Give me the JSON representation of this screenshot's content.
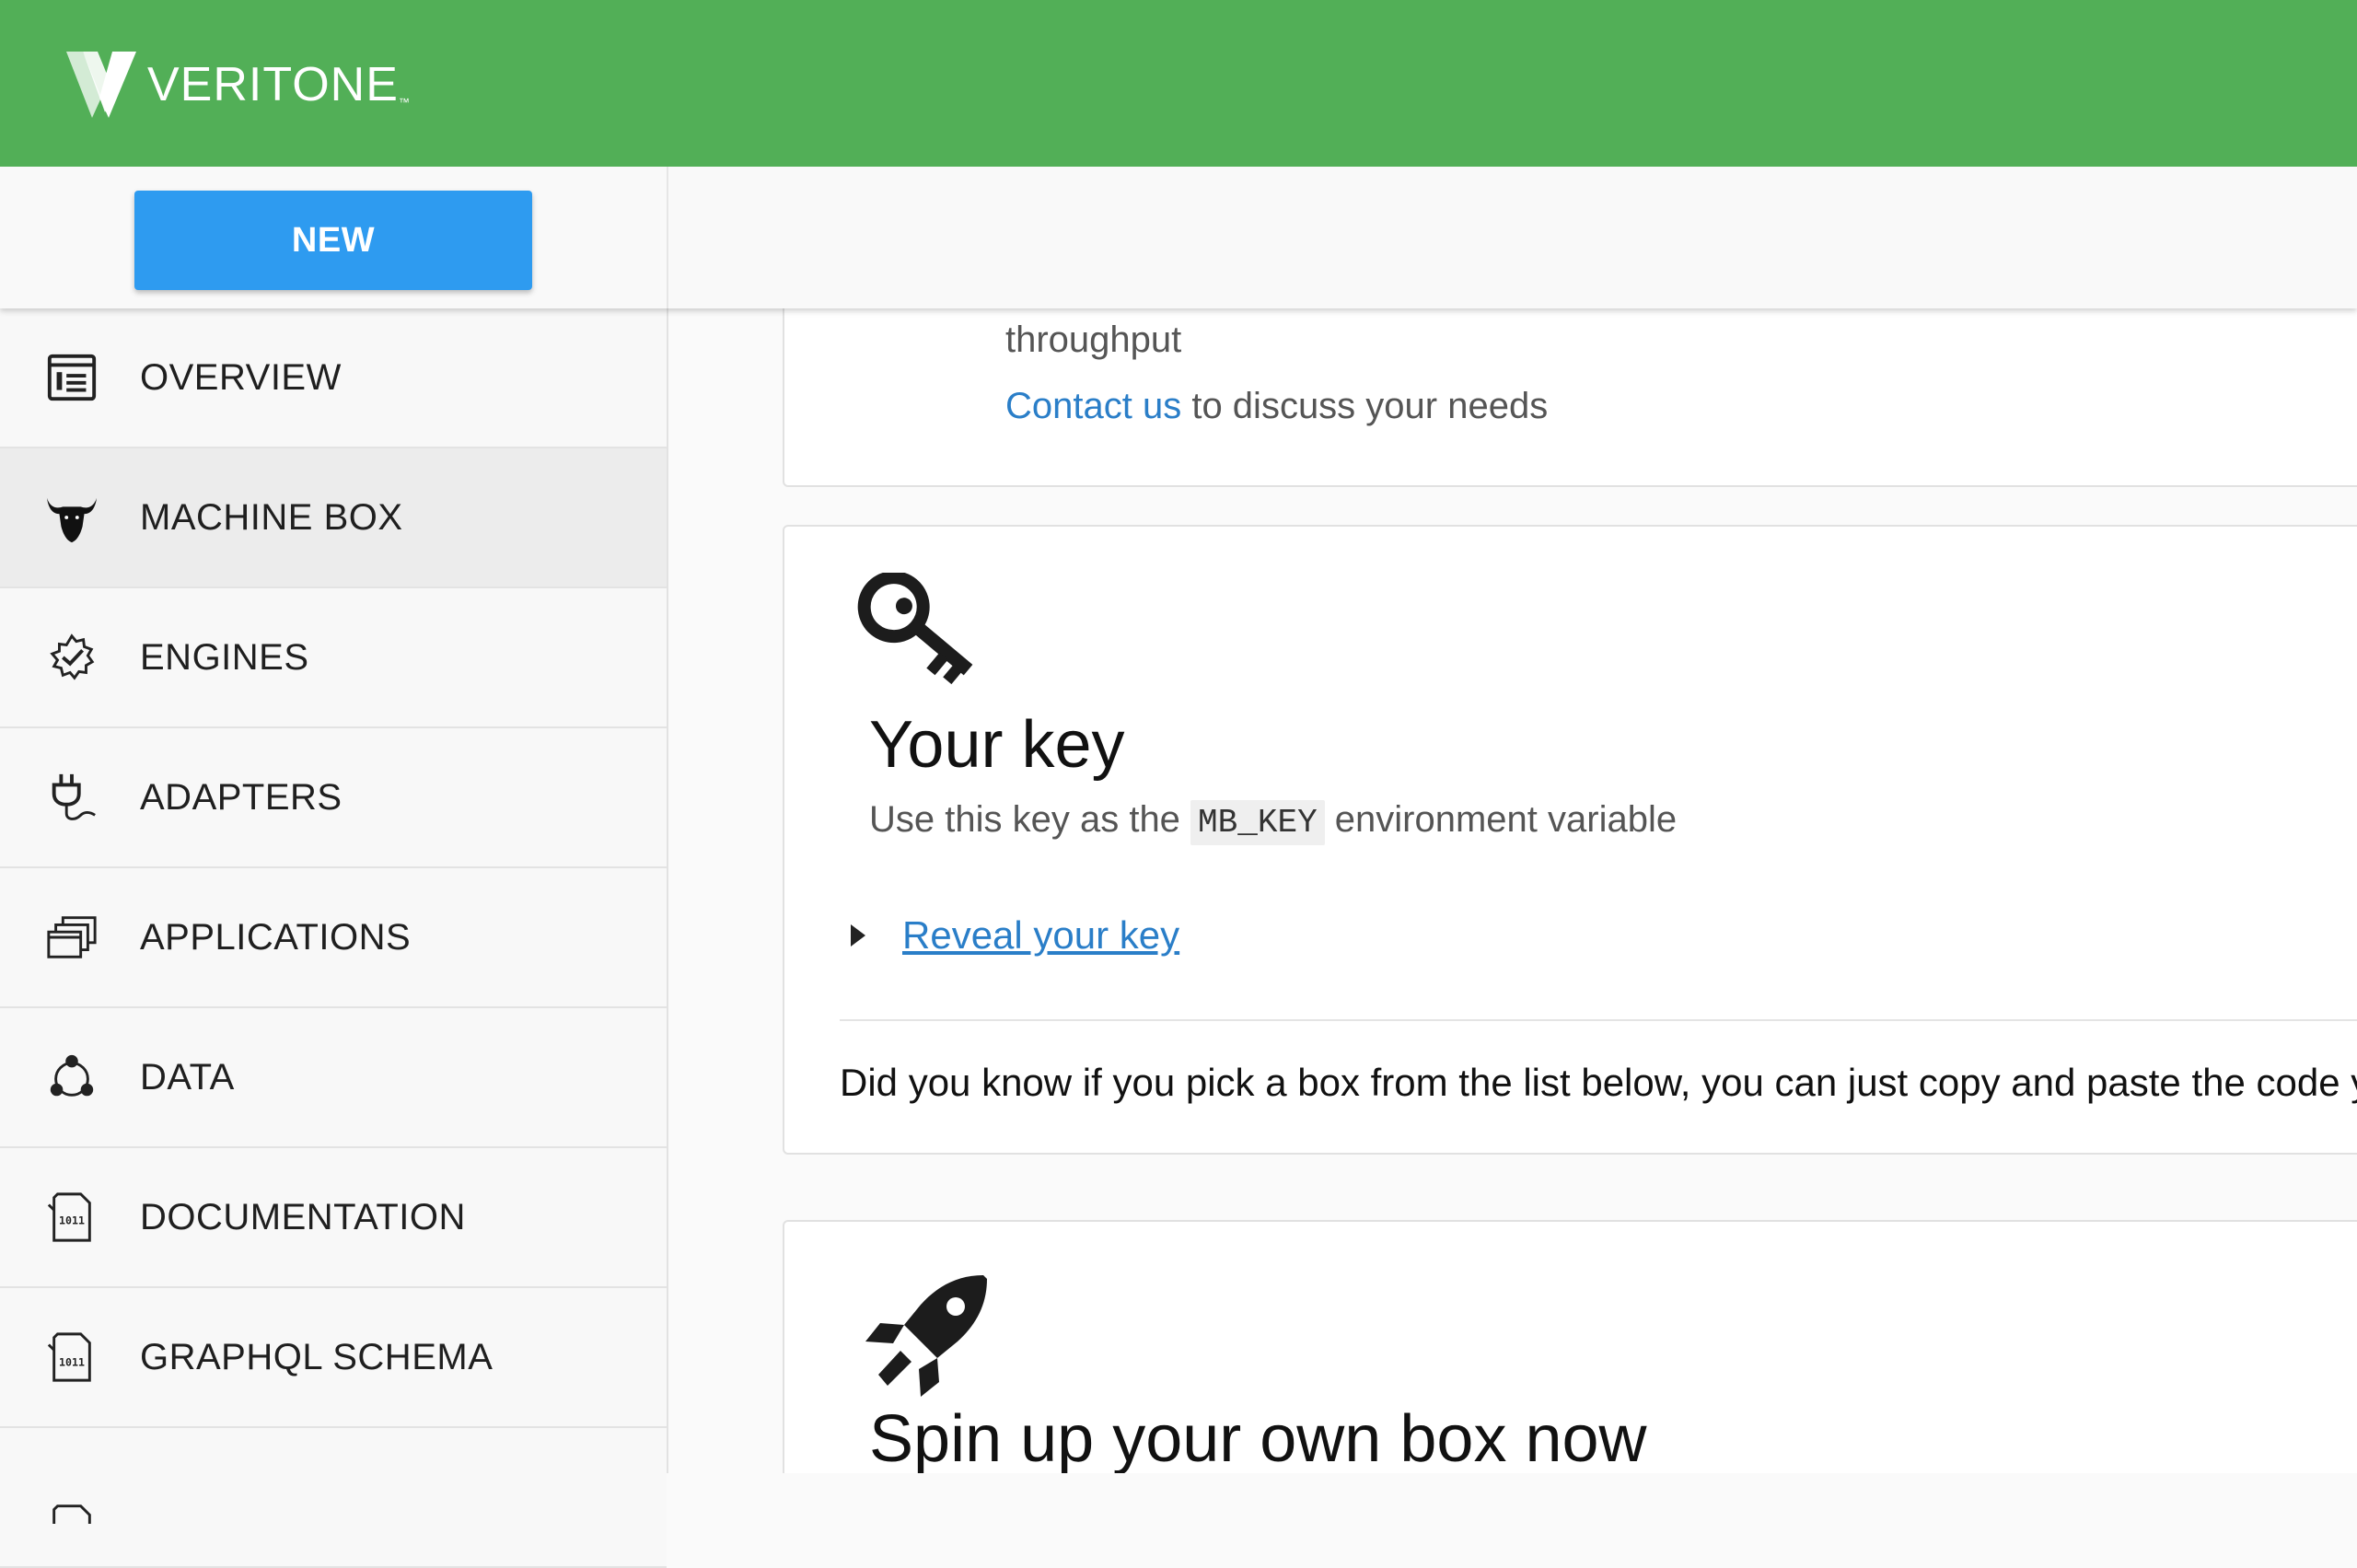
{
  "header": {
    "brand": "VERITONE",
    "trademark": "™",
    "bg_color": "#52af57"
  },
  "toolbar": {
    "new_label": "NEW",
    "accent": "#2e9bf0"
  },
  "sidebar": {
    "items": [
      {
        "label": "OVERVIEW",
        "icon": "overview-icon"
      },
      {
        "label": "MACHINE BOX",
        "icon": "bull-icon",
        "active": true
      },
      {
        "label": "ENGINES",
        "icon": "gear-check-icon"
      },
      {
        "label": "ADAPTERS",
        "icon": "plug-icon"
      },
      {
        "label": "APPLICATIONS",
        "icon": "windows-stack-icon"
      },
      {
        "label": "DATA",
        "icon": "network-icon"
      },
      {
        "label": "DOCUMENTATION",
        "icon": "binary-file-icon"
      },
      {
        "label": "GRAPHQL SCHEMA",
        "icon": "binary-file-icon"
      },
      {
        "label": "",
        "icon": "file-icon"
      }
    ]
  },
  "main": {
    "card1": {
      "throughput": "throughput",
      "contact_link": "Contact us",
      "contact_rest": " to discuss your needs"
    },
    "card2": {
      "icon": "key-icon",
      "title": "Your key",
      "subtitle_pre": "Use this key as the ",
      "subtitle_code": "MB_KEY",
      "subtitle_post": " environment variable",
      "reveal_label": "Reveal your key",
      "hint": "Did you know if you pick a box from the list below, you can just copy and paste the code you"
    },
    "card3": {
      "icon": "rocket-icon",
      "title": "Spin up your own box now"
    }
  },
  "colors": {
    "link": "#2a7ec8"
  }
}
